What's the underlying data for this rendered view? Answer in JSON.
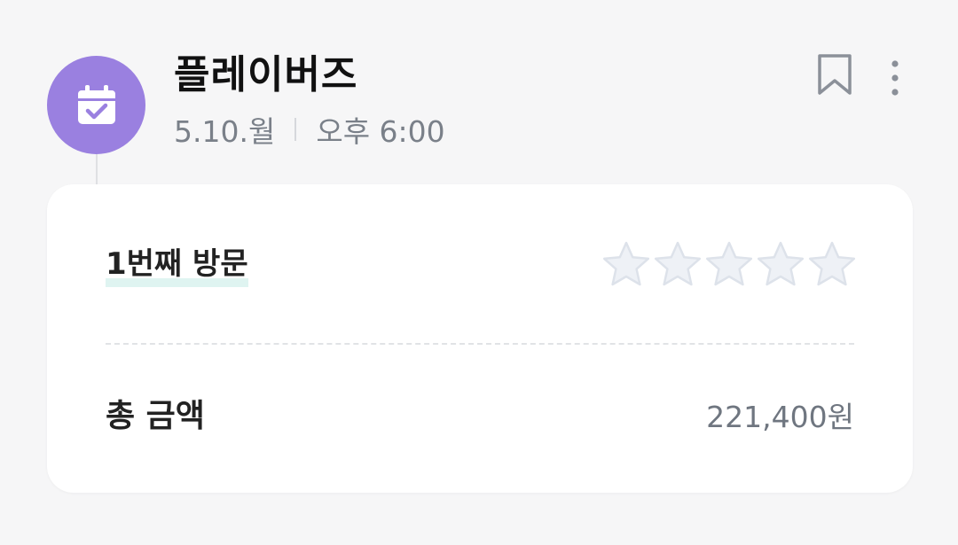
{
  "header": {
    "app_name": "플레이버즈",
    "date": "5.10.월",
    "time": "오후 6:00",
    "avatar_icon": "calendar-check-icon",
    "bookmark_icon": "bookmark-icon",
    "more_icon": "more-vertical-icon"
  },
  "card": {
    "visit_label": "1번째 방문",
    "rating": {
      "value": 0,
      "max": 5,
      "icon": "star-icon"
    },
    "total_label": "총 금액",
    "total_value": "221,400원"
  },
  "colors": {
    "accent": "#9a80e0",
    "star_fill": "#eef1f6",
    "star_stroke": "#dde2ea",
    "highlight": "#dff4f1"
  }
}
